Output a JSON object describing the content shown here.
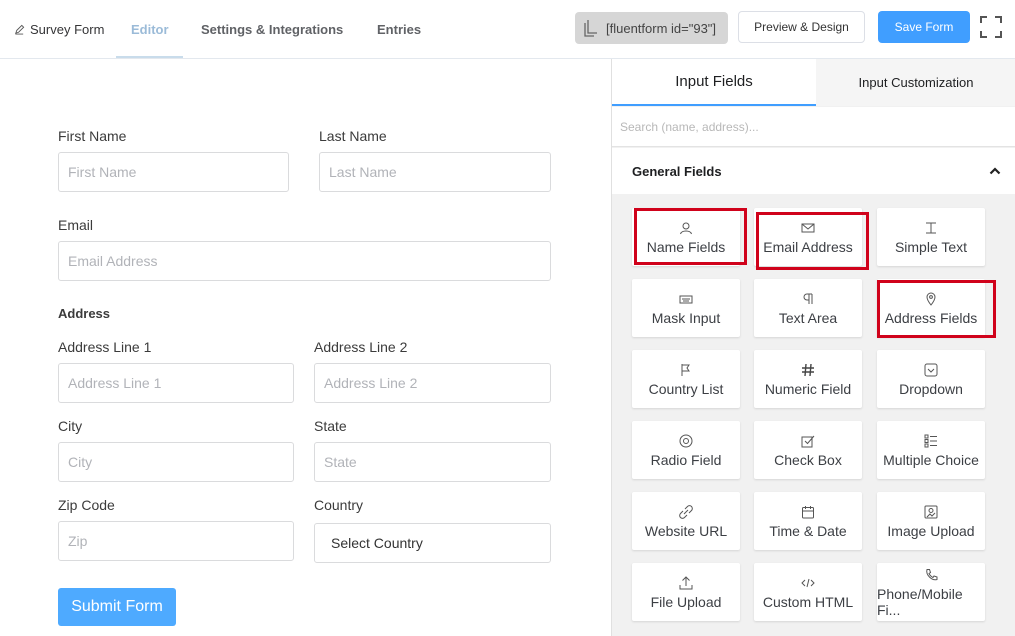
{
  "header": {
    "breadcrumb": "Survey Form",
    "tabs": [
      "Editor",
      "Settings & Integrations",
      "Entries"
    ],
    "active_tab": "Editor",
    "shortcode": "[fluentform id=\"93\"]",
    "preview_label": "Preview & Design",
    "save_label": "Save Form"
  },
  "form": {
    "first_name_label": "First Name",
    "first_name_placeholder": "First Name",
    "last_name_label": "Last Name",
    "last_name_placeholder": "Last Name",
    "email_label": "Email",
    "email_placeholder": "Email Address",
    "address_heading": "Address",
    "address1_label": "Address Line 1",
    "address1_placeholder": "Address Line 1",
    "address2_label": "Address Line 2",
    "address2_placeholder": "Address Line 2",
    "city_label": "City",
    "city_placeholder": "City",
    "state_label": "State",
    "state_placeholder": "State",
    "zip_label": "Zip Code",
    "zip_placeholder": "Zip",
    "country_label": "Country",
    "country_value": "Select Country",
    "submit_label": "Submit Form"
  },
  "panel": {
    "tabs": [
      "Input Fields",
      "Input Customization"
    ],
    "active_tab": "Input Fields",
    "search_placeholder": "Search (name, address)...",
    "section_title": "General Fields",
    "fields": [
      {
        "label": "Name Fields",
        "icon": "user-icon",
        "highlighted": true
      },
      {
        "label": "Email Address",
        "icon": "envelope-icon",
        "highlighted": true
      },
      {
        "label": "Simple Text",
        "icon": "text-cursor-icon",
        "highlighted": false
      },
      {
        "label": "Mask Input",
        "icon": "keyboard-icon",
        "highlighted": false
      },
      {
        "label": "Text Area",
        "icon": "paragraph-icon",
        "highlighted": false
      },
      {
        "label": "Address Fields",
        "icon": "map-pin-icon",
        "highlighted": true
      },
      {
        "label": "Country List",
        "icon": "flag-icon",
        "highlighted": false
      },
      {
        "label": "Numeric Field",
        "icon": "hash-icon",
        "highlighted": false
      },
      {
        "label": "Dropdown",
        "icon": "dropdown-icon",
        "highlighted": false
      },
      {
        "label": "Radio Field",
        "icon": "radio-icon",
        "highlighted": false
      },
      {
        "label": "Check Box",
        "icon": "checkbox-icon",
        "highlighted": false
      },
      {
        "label": "Multiple Choice",
        "icon": "list-icon",
        "highlighted": false
      },
      {
        "label": "Website URL",
        "icon": "link-icon",
        "highlighted": false
      },
      {
        "label": "Time & Date",
        "icon": "calendar-icon",
        "highlighted": false
      },
      {
        "label": "Image Upload",
        "icon": "image-icon",
        "highlighted": false
      },
      {
        "label": "File Upload",
        "icon": "upload-icon",
        "highlighted": false
      },
      {
        "label": "Custom HTML",
        "icon": "code-icon",
        "highlighted": false
      },
      {
        "label": "Phone/Mobile Fi...",
        "icon": "phone-icon",
        "highlighted": false
      }
    ]
  },
  "colors": {
    "accent": "#409eff",
    "highlight": "#d0021b",
    "submit": "#4eaaff"
  }
}
